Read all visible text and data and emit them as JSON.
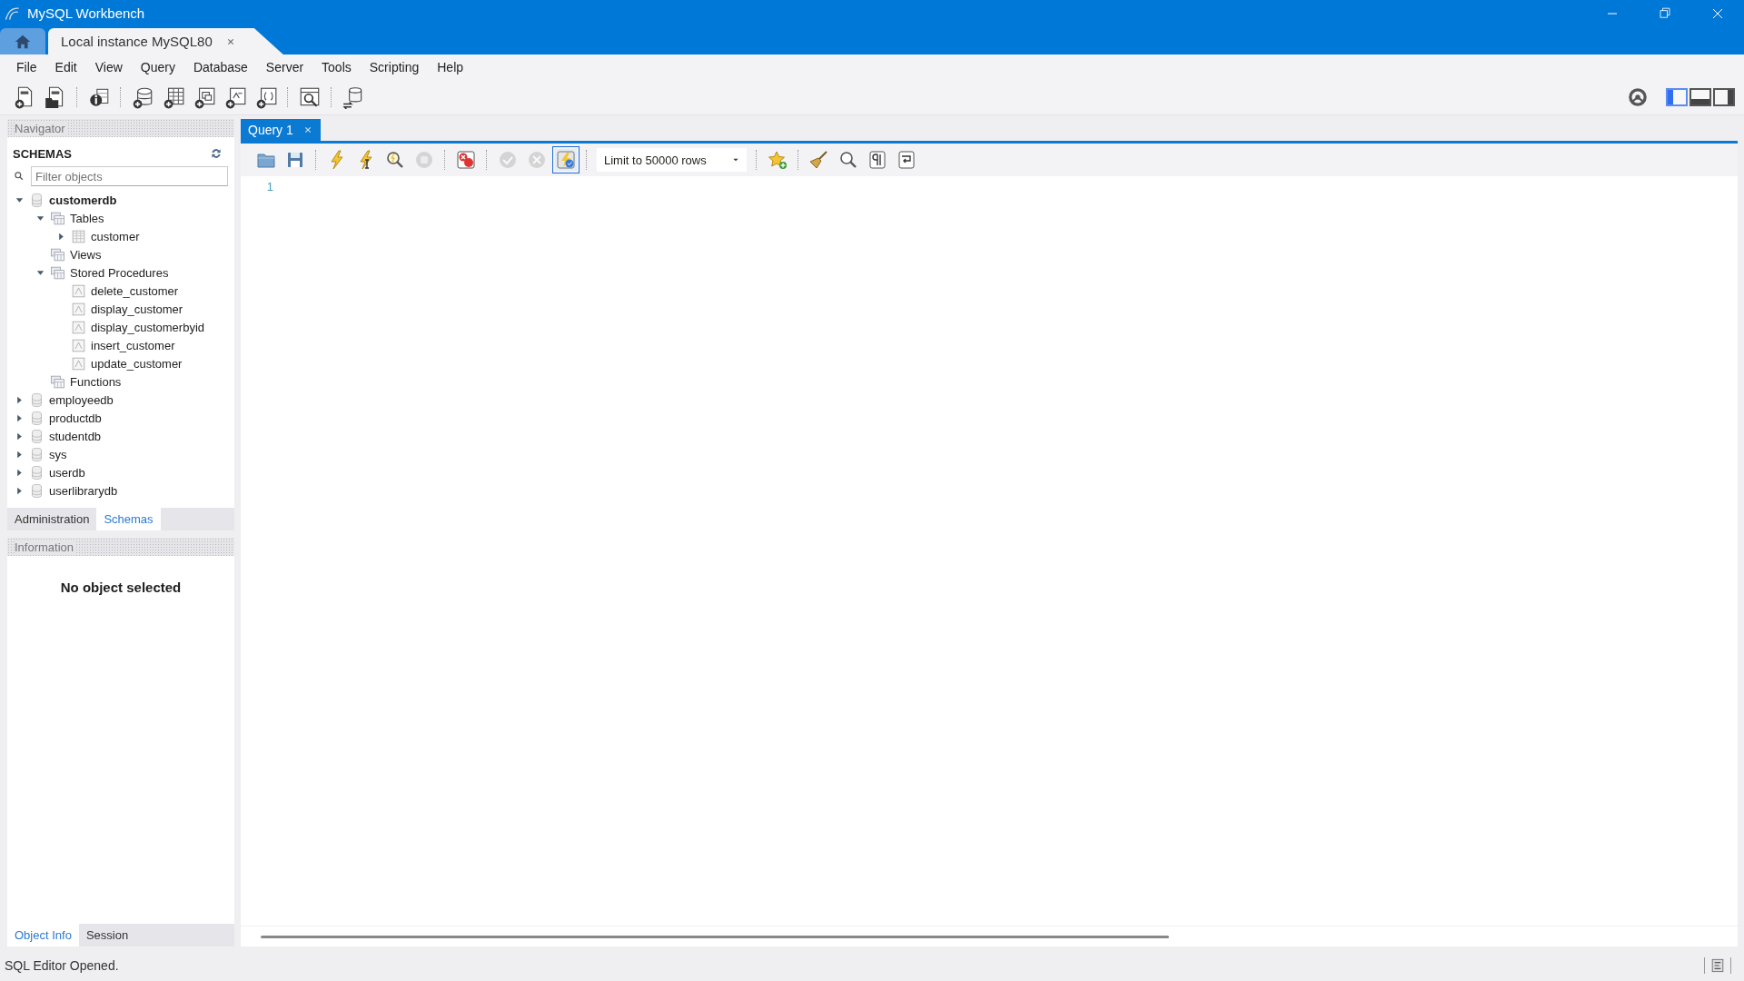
{
  "window": {
    "title": "MySQL Workbench"
  },
  "connection_tabs": [
    {
      "kind": "home",
      "selected": false
    },
    {
      "kind": "connection",
      "label": "Local instance MySQL80",
      "selected": true
    }
  ],
  "menu": [
    "File",
    "Edit",
    "View",
    "Query",
    "Database",
    "Server",
    "Tools",
    "Scripting",
    "Help"
  ],
  "layout_buttons": [
    {
      "selected": true
    },
    {
      "selected": false
    },
    {
      "selected": false
    }
  ],
  "navigator": {
    "title": "Navigator",
    "section": "SCHEMAS",
    "filter": {
      "placeholder": "Filter objects"
    },
    "tree": [
      {
        "kind": "schema",
        "label": "customerdb",
        "default": true,
        "expanded": true,
        "children": [
          {
            "kind": "folder",
            "label": "Tables",
            "expanded": true,
            "children": [
              {
                "kind": "table",
                "label": "customer",
                "expanded": false
              }
            ]
          },
          {
            "kind": "folder",
            "label": "Views"
          },
          {
            "kind": "folder",
            "label": "Stored Procedures",
            "expanded": true,
            "children": [
              {
                "kind": "routine",
                "label": "delete_customer"
              },
              {
                "kind": "routine",
                "label": "display_customer"
              },
              {
                "kind": "routine",
                "label": "display_customerbyid"
              },
              {
                "kind": "routine",
                "label": "insert_customer"
              },
              {
                "kind": "routine",
                "label": "update_customer"
              }
            ]
          },
          {
            "kind": "folder",
            "label": "Functions"
          }
        ]
      },
      {
        "kind": "schema",
        "label": "employeedb",
        "default": false,
        "expanded": false
      },
      {
        "kind": "schema",
        "label": "productdb",
        "default": false,
        "expanded": false
      },
      {
        "kind": "schema",
        "label": "studentdb",
        "default": false,
        "expanded": false
      },
      {
        "kind": "schema",
        "label": "sys",
        "default": false,
        "expanded": false
      },
      {
        "kind": "schema",
        "label": "userdb",
        "default": false,
        "expanded": false
      },
      {
        "kind": "schema",
        "label": "userlibrarydb",
        "default": false,
        "expanded": false
      }
    ],
    "tabs": [
      {
        "label": "Administration",
        "selected": false
      },
      {
        "label": "Schemas",
        "selected": true
      }
    ]
  },
  "information": {
    "title": "Information",
    "message": "No object selected",
    "tabs": [
      {
        "label": "Object Info",
        "selected": true
      },
      {
        "label": "Session",
        "selected": false
      }
    ]
  },
  "editor_tabs": [
    {
      "label": "Query 1",
      "selected": true
    }
  ],
  "query_toolbar": {
    "stop": {
      "disabled": true
    },
    "commit": {
      "disabled": true
    },
    "rollback": {
      "disabled": true
    },
    "auto_commit": {
      "on": true
    },
    "limit": {
      "value": "Limit to 50000 rows"
    }
  },
  "editor": {
    "line_numbers": [
      "1"
    ]
  },
  "status_bar": {
    "message": "SQL Editor Opened."
  }
}
